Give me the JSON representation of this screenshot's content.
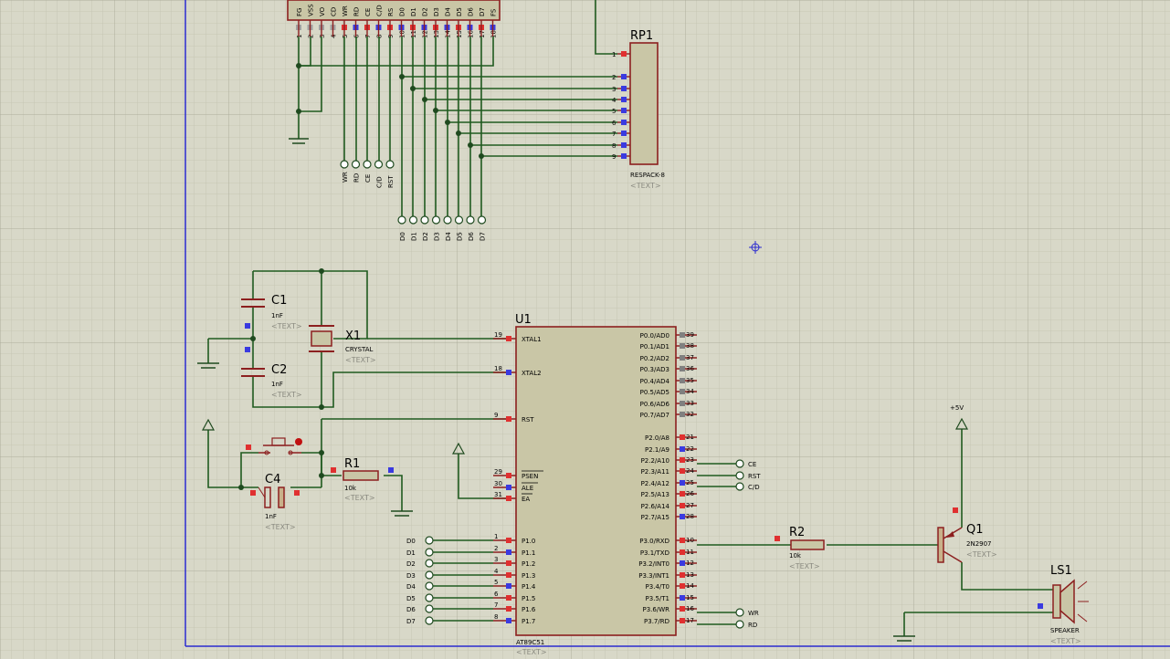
{
  "lcd_pins": {
    "labels": [
      "FG",
      "VSS",
      "VO",
      "CD",
      "WR",
      "RD",
      "CE",
      "C/D",
      "RS",
      "D0",
      "D1",
      "D2",
      "D3",
      "D4",
      "D5",
      "D6",
      "D7",
      "FS"
    ],
    "numbers": [
      "1",
      "2",
      "3",
      "4",
      "5",
      "6",
      "7",
      "8",
      "9",
      "10",
      "11",
      "12",
      "13",
      "14",
      "15",
      "16",
      "17",
      "18"
    ]
  },
  "lcd_control_terminals": [
    "WR",
    "RD",
    "CE",
    "C/D",
    "RST"
  ],
  "data_terminals_top": [
    "D0",
    "D1",
    "D2",
    "D3",
    "D4",
    "D5",
    "D6",
    "D7"
  ],
  "rp1": {
    "ref": "RP1",
    "pins": [
      "1",
      "2",
      "3",
      "4",
      "5",
      "6",
      "7",
      "8",
      "9"
    ],
    "value": "RESPACK-8",
    "text": "<TEXT>"
  },
  "c1": {
    "ref": "C1",
    "value": "1nF",
    "text": "<TEXT>"
  },
  "c2": {
    "ref": "C2",
    "value": "1nF",
    "text": "<TEXT>"
  },
  "c4": {
    "ref": "C4",
    "value": "1nF",
    "text": "<TEXT>"
  },
  "x1": {
    "ref": "X1",
    "value": "CRYSTAL",
    "text": "<TEXT>"
  },
  "r1": {
    "ref": "R1",
    "value": "10k",
    "text": "<TEXT>"
  },
  "r2": {
    "ref": "R2",
    "value": "10k",
    "text": "<TEXT>"
  },
  "q1": {
    "ref": "Q1",
    "value": "2N2907",
    "text": "<TEXT>"
  },
  "ls1": {
    "ref": "LS1",
    "value": "SPEAKER",
    "text": "<TEXT>"
  },
  "power_label": "+5V",
  "u1": {
    "ref": "U1",
    "value": "AT89C51",
    "text": "<TEXT>",
    "left_pins": [
      {
        "num": "19",
        "name": "XTAL1"
      },
      {
        "num": "18",
        "name": "XTAL2"
      },
      {
        "num": "9",
        "name": "RST"
      },
      {
        "num": "29",
        "name": "PSEN"
      },
      {
        "num": "30",
        "name": "ALE"
      },
      {
        "num": "31",
        "name": "EA"
      },
      {
        "num": "1",
        "name": "P1.0"
      },
      {
        "num": "2",
        "name": "P1.1"
      },
      {
        "num": "3",
        "name": "P1.2"
      },
      {
        "num": "4",
        "name": "P1.3"
      },
      {
        "num": "5",
        "name": "P1.4"
      },
      {
        "num": "6",
        "name": "P1.5"
      },
      {
        "num": "7",
        "name": "P1.6"
      },
      {
        "num": "8",
        "name": "P1.7"
      }
    ],
    "right_pins": [
      {
        "num": "39",
        "name": "P0.0/AD0"
      },
      {
        "num": "38",
        "name": "P0.1/AD1"
      },
      {
        "num": "37",
        "name": "P0.2/AD2"
      },
      {
        "num": "36",
        "name": "P0.3/AD3"
      },
      {
        "num": "35",
        "name": "P0.4/AD4"
      },
      {
        "num": "34",
        "name": "P0.5/AD5"
      },
      {
        "num": "33",
        "name": "P0.6/AD6"
      },
      {
        "num": "32",
        "name": "P0.7/AD7"
      },
      {
        "num": "21",
        "name": "P2.0/A8"
      },
      {
        "num": "22",
        "name": "P2.1/A9"
      },
      {
        "num": "23",
        "name": "P2.2/A10"
      },
      {
        "num": "24",
        "name": "P2.3/A11"
      },
      {
        "num": "25",
        "name": "P2.4/A12"
      },
      {
        "num": "26",
        "name": "P2.5/A13"
      },
      {
        "num": "27",
        "name": "P2.6/A14"
      },
      {
        "num": "28",
        "name": "P2.7/A15"
      },
      {
        "num": "10",
        "name": "P3.0/RXD"
      },
      {
        "num": "11",
        "name": "P3.1/TXD"
      },
      {
        "num": "12",
        "name": "P3.2/INT0"
      },
      {
        "num": "13",
        "name": "P3.3/INT1"
      },
      {
        "num": "14",
        "name": "P3.4/T0"
      },
      {
        "num": "15",
        "name": "P3.5/T1"
      },
      {
        "num": "16",
        "name": "P3.6/WR"
      },
      {
        "num": "17",
        "name": "P3.7/RD"
      }
    ]
  },
  "p1_terminals": [
    "D0",
    "D1",
    "D2",
    "D3",
    "D4",
    "D5",
    "D6",
    "D7"
  ],
  "p2_terminals": [
    "CE",
    "RST",
    "C/D"
  ],
  "p3_terminals": [
    "WR",
    "RD"
  ]
}
